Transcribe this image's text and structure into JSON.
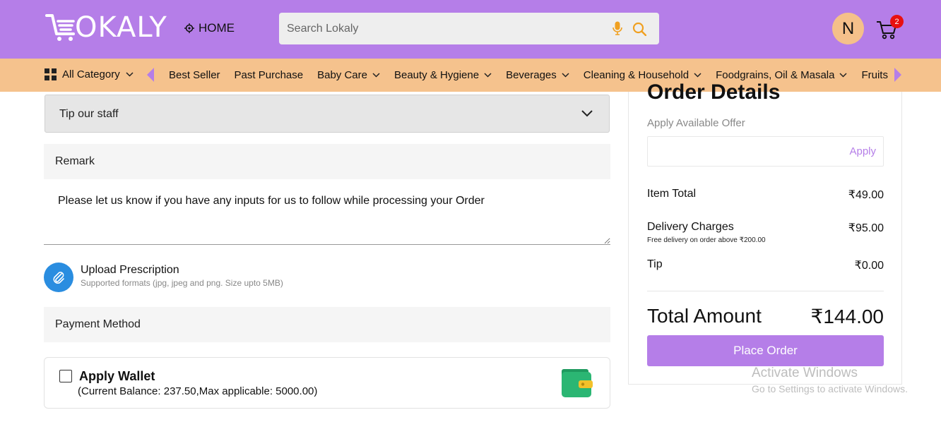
{
  "header": {
    "logo_text": "OKALY",
    "location_label": "HOME",
    "search_placeholder": "Search Lokaly",
    "avatar_initial": "N",
    "cart_count": "2"
  },
  "category_bar": {
    "all_category_label": "All Category",
    "items": [
      {
        "label": "Best Seller"
      },
      {
        "label": "Past Purchase"
      },
      {
        "label": "Baby Care"
      },
      {
        "label": "Beauty & Hygiene"
      },
      {
        "label": "Beverages"
      },
      {
        "label": "Cleaning & Household"
      },
      {
        "label": "Foodgrains, Oil & Masala"
      },
      {
        "label": "Fruits"
      }
    ]
  },
  "tip": {
    "label": "Tip our staff"
  },
  "remark": {
    "heading": "Remark",
    "placeholder": "Please let us know if you have any inputs for us to follow while processing your Order"
  },
  "upload": {
    "title": "Upload Prescription",
    "subtitle": "Supported formats (jpg, jpeg and png. Size upto 5MB)"
  },
  "payment": {
    "heading": "Payment Method",
    "wallet_title": "Apply Wallet",
    "wallet_details": "(Current Balance: 237.50,Max applicable: 5000.00)",
    "wallet_checked": false
  },
  "order": {
    "title": "Order Details",
    "offer_label": "Apply Available Offer",
    "apply_label": "Apply",
    "item_total_label": "Item Total",
    "item_total_value": "₹49.00",
    "delivery_label": "Delivery Charges",
    "delivery_value": "₹95.00",
    "delivery_note": "Free delivery on order above ₹200.00",
    "tip_label": "Tip",
    "tip_value": "₹0.00",
    "total_label": "Total Amount",
    "total_value": "₹144.00",
    "place_order_label": "Place Order"
  },
  "watermark": {
    "line1": "Activate Windows",
    "line2": "Go to Settings to activate Windows."
  },
  "colors": {
    "brand_purple": "#b57ee8",
    "category_orange": "#f5c28d",
    "badge_red": "#e81010",
    "icon_orange": "#f0a020",
    "clip_blue": "#2a8de0",
    "wallet_green": "#2bb673"
  },
  "icons": [
    "cart-logo-icon",
    "location-pin-icon",
    "mic-icon",
    "search-icon",
    "cart-icon",
    "grid-icon",
    "chevron-down-icon",
    "arrow-left-icon",
    "arrow-right-icon",
    "paperclip-icon",
    "wallet-icon"
  ]
}
